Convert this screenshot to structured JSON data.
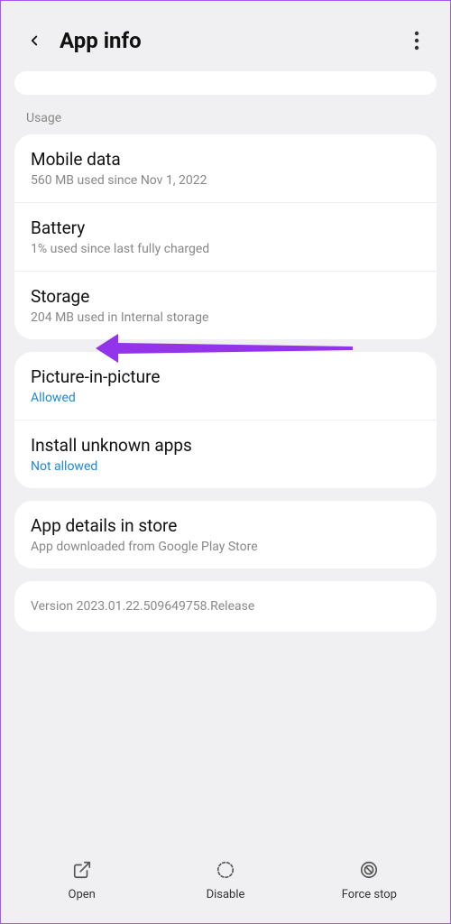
{
  "header": {
    "title": "App info"
  },
  "section_label": "Usage",
  "usage_items": [
    {
      "title": "Mobile data",
      "sub": "560 MB used since Nov 1, 2022"
    },
    {
      "title": "Battery",
      "sub": "1% used since last fully charged"
    },
    {
      "title": "Storage",
      "sub": "204 MB used in Internal storage"
    }
  ],
  "perm_items": [
    {
      "title": "Picture-in-picture",
      "sub": "Allowed"
    },
    {
      "title": "Install unknown apps",
      "sub": "Not allowed"
    }
  ],
  "details": {
    "title": "App details in store",
    "sub": "App downloaded from Google Play Store"
  },
  "version": "Version 2023.01.22.509649758.Release",
  "bottom": {
    "open": "Open",
    "disable": "Disable",
    "force_stop": "Force stop"
  }
}
